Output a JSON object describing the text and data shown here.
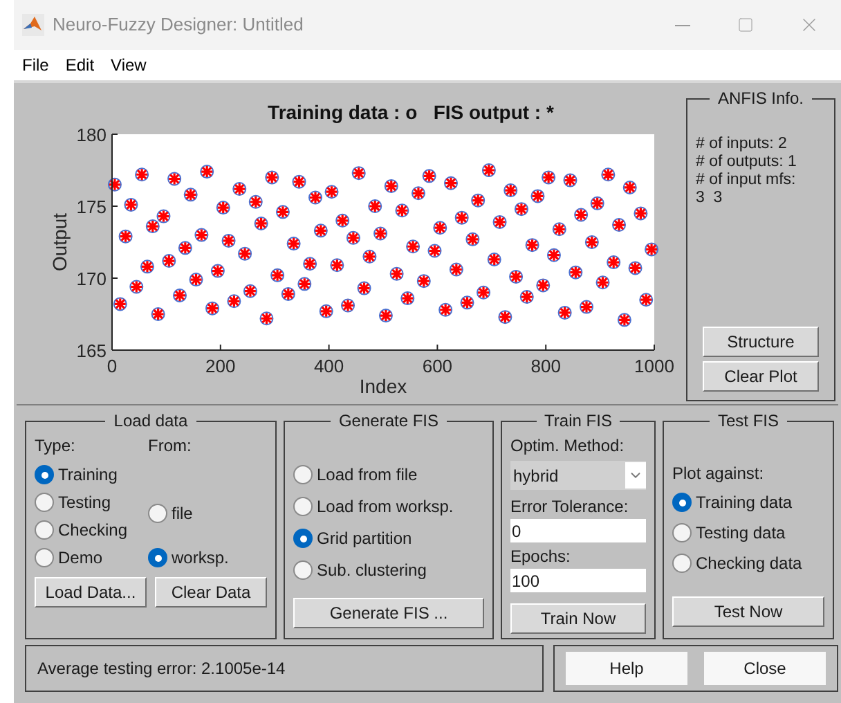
{
  "window": {
    "title": "Neuro-Fuzzy Designer: Untitled"
  },
  "menu": [
    "File",
    "Edit",
    "View"
  ],
  "plot": {
    "chart_data": {
      "type": "scatter",
      "xlabel": "Index",
      "ylabel": "Output",
      "xlim": [
        0,
        1000
      ],
      "ylim": [
        165,
        180
      ],
      "xticks": [
        0,
        200,
        400,
        600,
        800,
        1000
      ],
      "yticks": [
        165,
        170,
        175,
        180
      ],
      "x": [
        5,
        15,
        25,
        35,
        45,
        55,
        65,
        75,
        85,
        95,
        105,
        115,
        125,
        135,
        145,
        155,
        165,
        175,
        185,
        195,
        205,
        215,
        225,
        235,
        245,
        255,
        265,
        275,
        285,
        295,
        305,
        315,
        325,
        335,
        345,
        355,
        365,
        375,
        385,
        395,
        405,
        415,
        425,
        435,
        445,
        455,
        465,
        475,
        485,
        495,
        505,
        515,
        525,
        535,
        545,
        555,
        565,
        575,
        585,
        595,
        605,
        615,
        625,
        635,
        645,
        655,
        665,
        675,
        685,
        695,
        705,
        715,
        725,
        735,
        745,
        755,
        765,
        775,
        785,
        795,
        805,
        815,
        825,
        835,
        845,
        855,
        865,
        875,
        885,
        895,
        905,
        915,
        925,
        935,
        945,
        955,
        965,
        975,
        985,
        995
      ],
      "series": [
        {
          "name": "Training data : o",
          "marker": "circle",
          "color": "#4a6fd0",
          "values": [
            176.5,
            168.2,
            172.9,
            175.1,
            169.4,
            177.2,
            170.8,
            173.6,
            167.5,
            174.3,
            171.2,
            176.9,
            168.8,
            172.1,
            175.8,
            169.9,
            173.0,
            177.4,
            167.9,
            170.5,
            174.9,
            172.6,
            168.4,
            176.2,
            171.7,
            169.1,
            175.3,
            173.8,
            167.2,
            177.0,
            170.2,
            174.6,
            168.9,
            172.4,
            176.7,
            169.6,
            171.0,
            175.6,
            173.3,
            167.7,
            176.0,
            170.9,
            174.0,
            168.1,
            172.8,
            177.3,
            169.3,
            171.5,
            175.0,
            173.1,
            167.4,
            176.4,
            170.3,
            174.7,
            168.6,
            172.2,
            175.9,
            169.8,
            177.1,
            171.9,
            173.5,
            167.8,
            176.6,
            170.6,
            174.2,
            168.3,
            172.7,
            175.4,
            169.0,
            177.5,
            171.3,
            173.9,
            167.3,
            176.1,
            170.1,
            174.8,
            168.7,
            172.3,
            175.7,
            169.5,
            177.0,
            171.6,
            173.4,
            167.6,
            176.8,
            170.4,
            174.4,
            168.0,
            172.5,
            175.2,
            169.7,
            177.2,
            171.1,
            173.7,
            167.1,
            176.3,
            170.7,
            174.5,
            168.5,
            172.0
          ]
        },
        {
          "name": "FIS output : *",
          "marker": "cross",
          "color": "#ff0000",
          "values": [
            176.5,
            168.2,
            172.9,
            175.1,
            169.4,
            177.2,
            170.8,
            173.6,
            167.5,
            174.3,
            171.2,
            176.9,
            168.8,
            172.1,
            175.8,
            169.9,
            173.0,
            177.4,
            167.9,
            170.5,
            174.9,
            172.6,
            168.4,
            176.2,
            171.7,
            169.1,
            175.3,
            173.8,
            167.2,
            177.0,
            170.2,
            174.6,
            168.9,
            172.4,
            176.7,
            169.6,
            171.0,
            175.6,
            173.3,
            167.7,
            176.0,
            170.9,
            174.0,
            168.1,
            172.8,
            177.3,
            169.3,
            171.5,
            175.0,
            173.1,
            167.4,
            176.4,
            170.3,
            174.7,
            168.6,
            172.2,
            175.9,
            169.8,
            177.1,
            171.9,
            173.5,
            167.8,
            176.6,
            170.6,
            174.2,
            168.3,
            172.7,
            175.4,
            169.0,
            177.5,
            171.3,
            173.9,
            167.3,
            176.1,
            170.1,
            174.8,
            168.7,
            172.3,
            175.7,
            169.5,
            177.0,
            171.6,
            173.4,
            167.6,
            176.8,
            170.4,
            174.4,
            168.0,
            172.5,
            175.2,
            169.7,
            177.2,
            171.1,
            173.7,
            167.1,
            176.3,
            170.7,
            174.5,
            168.5,
            172.0
          ]
        }
      ]
    }
  },
  "anfis_info": {
    "title": "ANFIS Info.",
    "lines": [
      "# of inputs: 2",
      "# of outputs: 1",
      "# of input mfs:",
      "3  3"
    ],
    "buttons": [
      "Structure",
      "Clear Plot"
    ]
  },
  "load_data": {
    "title": "Load data",
    "type_label": "Type:",
    "from_label": "From:",
    "types": [
      {
        "label": "Training",
        "selected": true
      },
      {
        "label": "Testing",
        "selected": false
      },
      {
        "label": "Checking",
        "selected": false
      },
      {
        "label": "Demo",
        "selected": false
      }
    ],
    "sources": [
      {
        "label": "file",
        "selected": false
      },
      {
        "label": "worksp.",
        "selected": true
      }
    ],
    "buttons": [
      "Load Data...",
      "Clear Data"
    ]
  },
  "generate_fis": {
    "title": "Generate FIS",
    "options": [
      {
        "label": "Load from file",
        "selected": false
      },
      {
        "label": "Load from worksp.",
        "selected": false
      },
      {
        "label": "Grid partition",
        "selected": true
      },
      {
        "label": "Sub. clustering",
        "selected": false
      }
    ],
    "button": "Generate FIS ..."
  },
  "train_fis": {
    "title": "Train FIS",
    "method_label": "Optim. Method:",
    "method": "hybrid",
    "tolerance_label": "Error Tolerance:",
    "tolerance": "0",
    "epochs_label": "Epochs:",
    "epochs": "100",
    "button": "Train Now"
  },
  "test_fis": {
    "title": "Test FIS",
    "plot_label": "Plot against:",
    "options": [
      {
        "label": "Training data",
        "selected": true
      },
      {
        "label": "Testing data",
        "selected": false
      },
      {
        "label": "Checking data",
        "selected": false
      }
    ],
    "button": "Test Now"
  },
  "status": "Average testing error: 2.1005e-14",
  "buttons": [
    "Help",
    "Close"
  ]
}
